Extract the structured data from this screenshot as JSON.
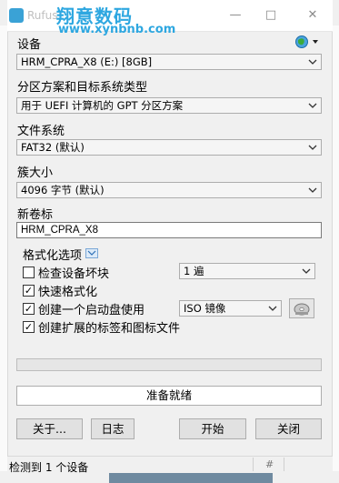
{
  "window": {
    "app_title": "Rufus",
    "watermark_title": "翔意数码",
    "watermark_url": "www.xynbnb.com"
  },
  "device": {
    "label": "设备",
    "value": "HRM_CPRA_X8 (E:) [8GB]"
  },
  "partition": {
    "label": "分区方案和目标系统类型",
    "value": "用于 UEFI 计算机的 GPT 分区方案"
  },
  "filesystem": {
    "label": "文件系统",
    "value": "FAT32 (默认)"
  },
  "cluster": {
    "label": "簇大小",
    "value": "4096 字节 (默认)"
  },
  "volume": {
    "label": "新卷标",
    "value": "HRM_CPRA_X8"
  },
  "format_options": {
    "legend": "格式化选项",
    "check_bad_blocks": {
      "label": "检查设备坏块",
      "checked": false
    },
    "passes": "1 遍",
    "quick_format": {
      "label": "快速格式化",
      "checked": true
    },
    "bootable": {
      "label": "创建一个启动盘使用",
      "checked": true
    },
    "boot_type": "ISO 镜像",
    "extended_label": {
      "label": "创建扩展的标签和图标文件",
      "checked": true
    }
  },
  "progress": {
    "value": 0
  },
  "status": "准备就绪",
  "buttons": {
    "about": "关于...",
    "log": "日志",
    "start": "开始",
    "close": "关闭"
  },
  "statusbar": {
    "text": "检测到 1 个设备",
    "hash": "#"
  },
  "colors": {
    "accent_blue": "#2ea7e0",
    "combo_bg": "#f5f5f5",
    "button_bg": "#e1e1e1"
  }
}
